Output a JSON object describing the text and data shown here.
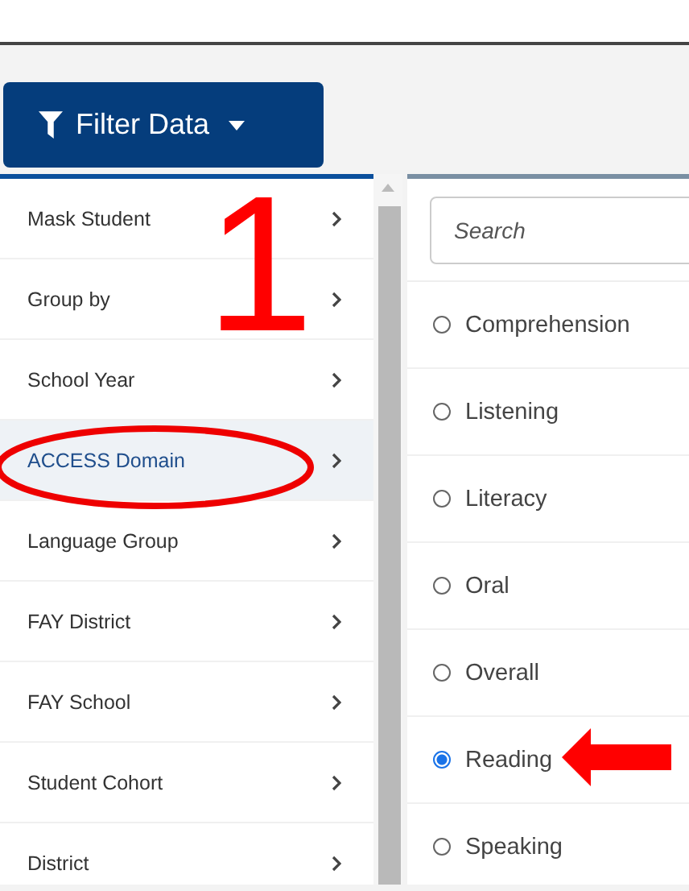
{
  "filter_button": {
    "label": "Filter Data"
  },
  "menu": [
    {
      "label": "Mask Student",
      "selected": false
    },
    {
      "label": "Group by",
      "selected": false
    },
    {
      "label": "School Year",
      "selected": false
    },
    {
      "label": "ACCESS Domain",
      "selected": true
    },
    {
      "label": "Language Group",
      "selected": false
    },
    {
      "label": "FAY District",
      "selected": false
    },
    {
      "label": "FAY School",
      "selected": false
    },
    {
      "label": "Student Cohort",
      "selected": false
    },
    {
      "label": "District",
      "selected": false
    }
  ],
  "search": {
    "placeholder": "Search"
  },
  "options": [
    {
      "label": "Comprehension",
      "selected": false
    },
    {
      "label": "Listening",
      "selected": false
    },
    {
      "label": "Literacy",
      "selected": false
    },
    {
      "label": "Oral",
      "selected": false
    },
    {
      "label": "Overall",
      "selected": false
    },
    {
      "label": "Reading",
      "selected": true
    },
    {
      "label": "Speaking",
      "selected": false
    }
  ],
  "annotation": {
    "step": "1"
  }
}
